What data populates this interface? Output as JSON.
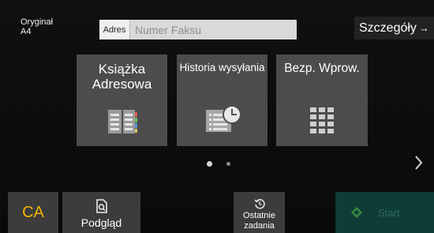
{
  "header": {
    "original_line1": "Oryginał",
    "original_line2": "A4",
    "address_label": "Adres",
    "address_placeholder": "Numer Faksu",
    "details_label": "Szczegóły",
    "details_arrow": "→"
  },
  "tiles": [
    {
      "line1": "Książka",
      "line2": "Adresowa",
      "icon": "address-book-icon"
    },
    {
      "line1": "Historia wysyłania",
      "icon": "send-history-icon"
    },
    {
      "line1": "Bezp. Wprow.",
      "icon": "keypad-icon"
    }
  ],
  "pager": {
    "pages": 2,
    "active": 1
  },
  "bottom": {
    "ca_label": "CA",
    "preview_label": "Podgląd",
    "recent_line1": "Ostatnie",
    "recent_line2": "zadania",
    "start_label": "Start"
  },
  "colors": {
    "ca": "#f2b400",
    "start_bg": "#0f3d36",
    "start_text": "#2f6a60",
    "tile_bg": "#4c4c4c"
  }
}
